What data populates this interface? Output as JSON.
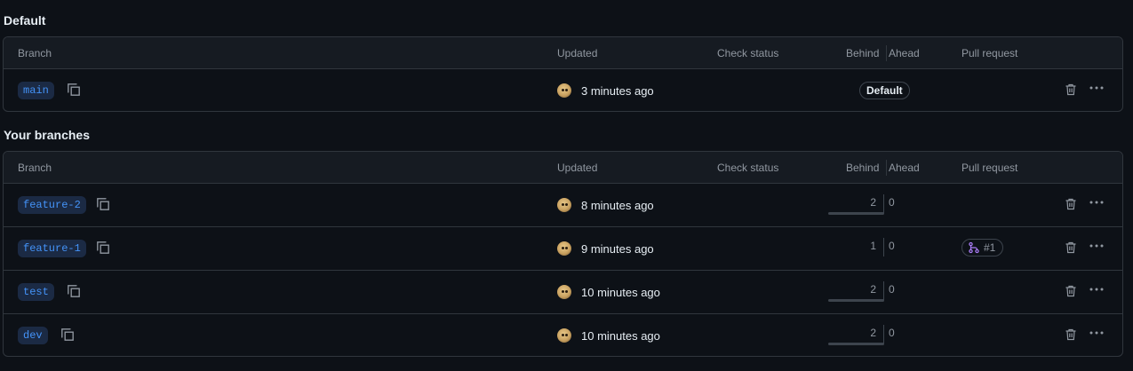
{
  "sections": {
    "default": {
      "title": "Default",
      "headers": {
        "branch": "Branch",
        "updated": "Updated",
        "check": "Check status",
        "behind": "Behind",
        "ahead": "Ahead",
        "pr": "Pull request"
      },
      "rows": [
        {
          "branch": "main",
          "updated": "3 minutes ago",
          "badge": "Default"
        }
      ]
    },
    "yours": {
      "title": "Your branches",
      "headers": {
        "branch": "Branch",
        "updated": "Updated",
        "check": "Check status",
        "behind": "Behind",
        "ahead": "Ahead",
        "pr": "Pull request"
      },
      "rows": [
        {
          "branch": "feature-2",
          "updated": "8 minutes ago",
          "behind": "2",
          "ahead": "0",
          "pr": ""
        },
        {
          "branch": "feature-1",
          "updated": "9 minutes ago",
          "behind": "1",
          "ahead": "0",
          "pr": "#1"
        },
        {
          "branch": "test",
          "updated": "10 minutes ago",
          "behind": "2",
          "ahead": "0",
          "pr": ""
        },
        {
          "branch": "dev",
          "updated": "10 minutes ago",
          "behind": "2",
          "ahead": "0",
          "pr": ""
        }
      ]
    }
  },
  "icons": {
    "copy": "copy-icon",
    "trash": "trash-icon",
    "more": "kebab-horizontal-icon",
    "pr": "git-pull-request-icon"
  },
  "colors": {
    "background": "#0d1117",
    "header_bg": "#161b22",
    "border": "#30363d",
    "branch_text": "#4493f8",
    "branch_bg": "#1b2a44",
    "pr_icon": "#ab7df8"
  }
}
